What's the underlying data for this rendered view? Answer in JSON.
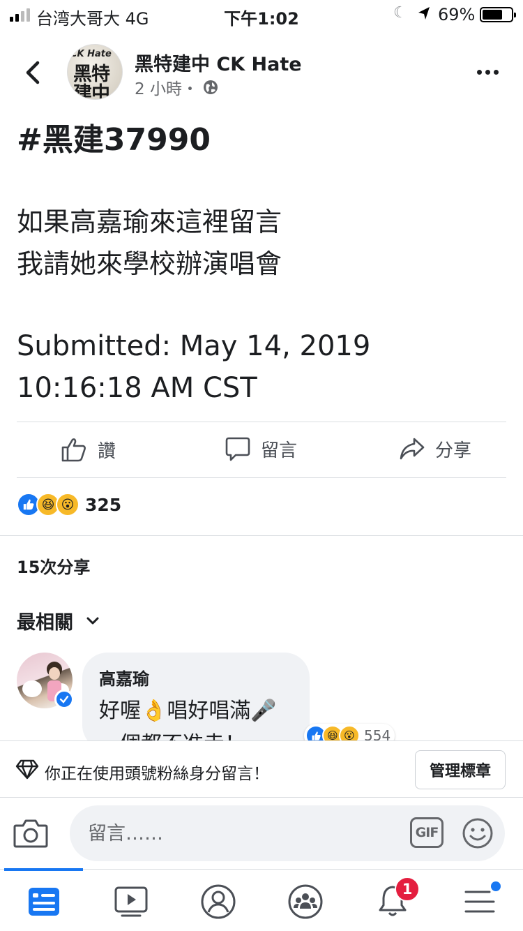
{
  "status_bar": {
    "carrier": "台湾大哥大  4G",
    "time": "下午1:02",
    "battery": "69%",
    "battery_level": 0.69
  },
  "header": {
    "page_name": "黑特建中 CK Hate",
    "timestamp": "2 小時・",
    "avatar_text_top": "CK Hate",
    "avatar_text_line1": "黑特",
    "avatar_text_line2": "建中"
  },
  "post": {
    "hashtag": "#黑建37990",
    "lines": [
      "如果高嘉瑜來這裡留言",
      "我請她來學校辦演唱會"
    ],
    "submitted_line1": "Submitted:  May 14, 2019",
    "submitted_line2": "10:16:18 AM CST"
  },
  "actions": {
    "like": "讚",
    "comment": "留言",
    "share": "分享"
  },
  "reactions": {
    "count": "325"
  },
  "shares": "15次分享",
  "sort_label": "最相關",
  "comment": {
    "author": "高嘉瑜",
    "line1": "好喔👌唱好唱滿🎤",
    "line2": "一個都不准走！",
    "reaction_count": "554"
  },
  "fan_bar": {
    "text": "你正在使用頭號粉絲身分留言！",
    "manage_button": "管理標章"
  },
  "composer": {
    "placeholder": "留言……",
    "gif_label": "GIF"
  },
  "tab_bar": {
    "notification_count": "1"
  },
  "colors": {
    "accent": "#1877f2",
    "badge": "#e41e3f",
    "secondary_text": "#65676b"
  }
}
